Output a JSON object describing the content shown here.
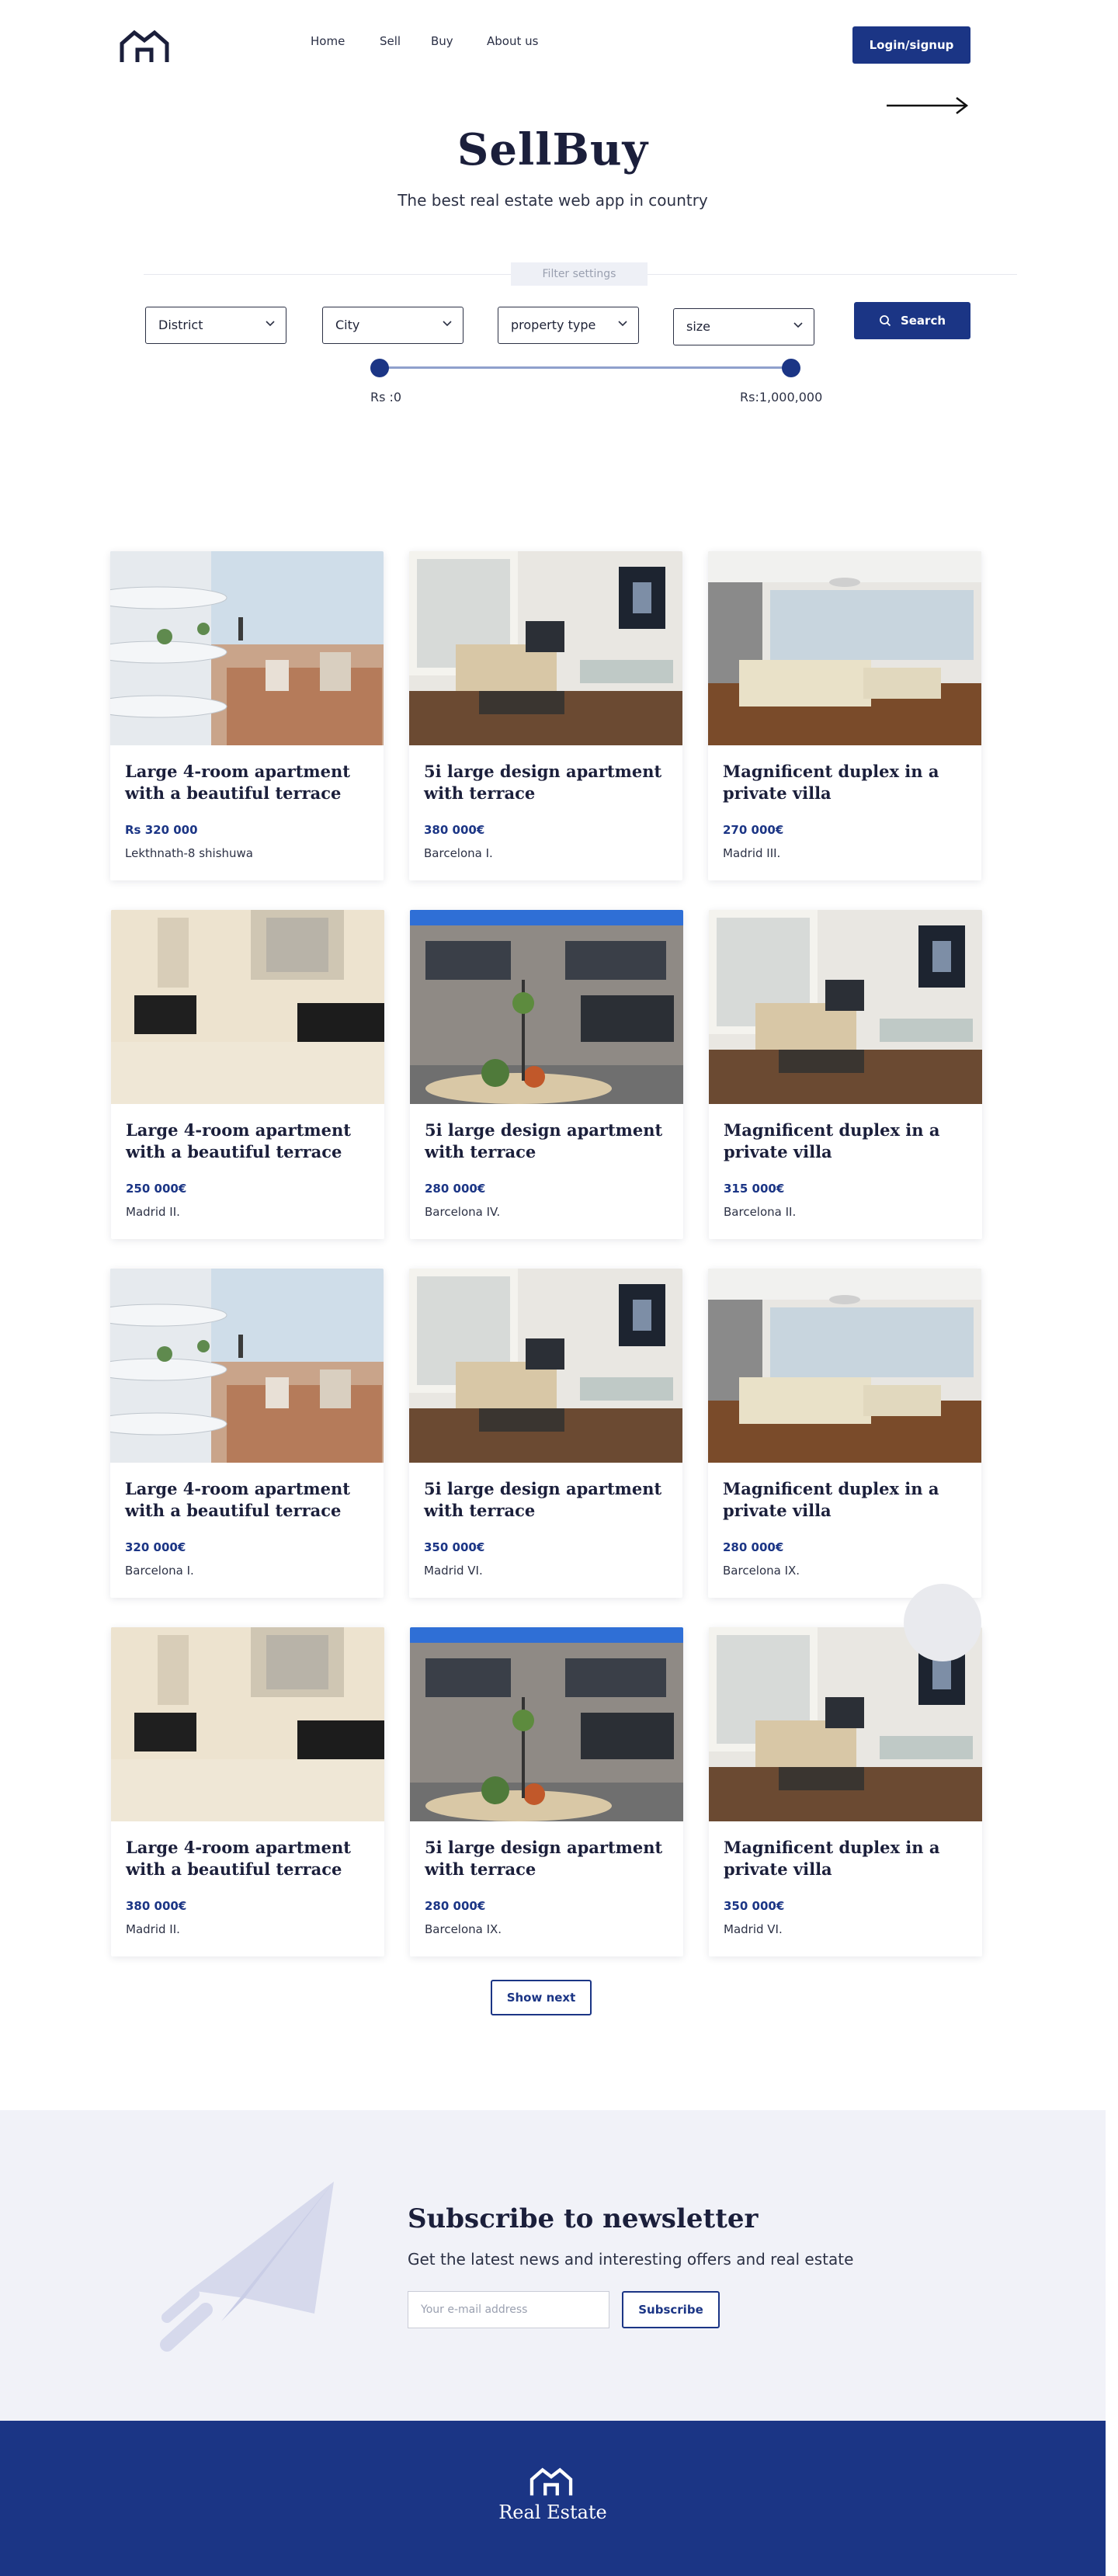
{
  "header": {
    "logo_icon": "house-logo-icon",
    "nav": [
      "Home",
      "Sell",
      "Buy",
      "About us"
    ],
    "login_label": "Login/signup",
    "arrow_icon": "arrow-right-icon"
  },
  "hero": {
    "title": "SellBuy",
    "subtitle": "The best real estate web app in country"
  },
  "filters": {
    "label": "Filter settings",
    "district": "District",
    "city": "City",
    "property_type": "property type",
    "size": "size",
    "search_label": "Search",
    "range_min_label": "Rs :0",
    "range_max_label": "Rs:1,000,000"
  },
  "listings": [
    {
      "title": "Large 4-room apartment with a beautiful terrace",
      "price": "Rs 320 000",
      "location": "Lekthnath-8 shishuwa",
      "image": "balcony"
    },
    {
      "title": "5i large design apartment with terrace",
      "price": "380 000€",
      "location": "Barcelona I.",
      "image": "living"
    },
    {
      "title": "Magnificent duplex in a private villa",
      "price": "270 000€",
      "location": "Madrid III.",
      "image": "villa"
    },
    {
      "title": "Large 4-room apartment with a beautiful terrace",
      "price": "250 000€",
      "location": "Madrid II.",
      "image": "bathroom"
    },
    {
      "title": "5i large design apartment with terrace",
      "price": "280 000€",
      "location": "Barcelona IV.",
      "image": "building"
    },
    {
      "title": "Magnificent duplex in a private villa",
      "price": "315 000€",
      "location": "Barcelona II.",
      "image": "living"
    },
    {
      "title": "Large 4-room apartment with a beautiful terrace",
      "price": "320 000€",
      "location": "Barcelona  I.",
      "image": "balcony"
    },
    {
      "title": "5i large design apartment with terrace",
      "price": "350 000€",
      "location": "Madrid VI.",
      "image": "living"
    },
    {
      "title": "Magnificent duplex in a private villa",
      "price": "280 000€",
      "location": "Barcelona IX.",
      "image": "villa"
    },
    {
      "title": "Large 4-room apartment with a beautiful terrace",
      "price": "380 000€",
      "location": "Madrid II.",
      "image": "bathroom"
    },
    {
      "title": "5i large design apartment with terrace",
      "price": "280 000€",
      "location": "Barcelona IX.",
      "image": "building"
    },
    {
      "title": "Magnificent duplex in a private villa",
      "price": "350 000€",
      "location": "Madrid VI.",
      "image": "living"
    }
  ],
  "show_next_label": "Show next",
  "newsletter": {
    "icon": "paper-plane-icon",
    "title": "Subscribe to newsletter",
    "subtitle": "Get the latest news and interesting offers and real estate",
    "email_placeholder": "Your e-mail address",
    "subscribe_label": "Subscribe"
  },
  "footer": {
    "logo_icon": "house-logo-icon",
    "brand": "Real Estate"
  },
  "colors": {
    "brand": "#1b3585",
    "text_dark": "#1b1f3b",
    "newsletter_bg": "#f1f2f8"
  }
}
